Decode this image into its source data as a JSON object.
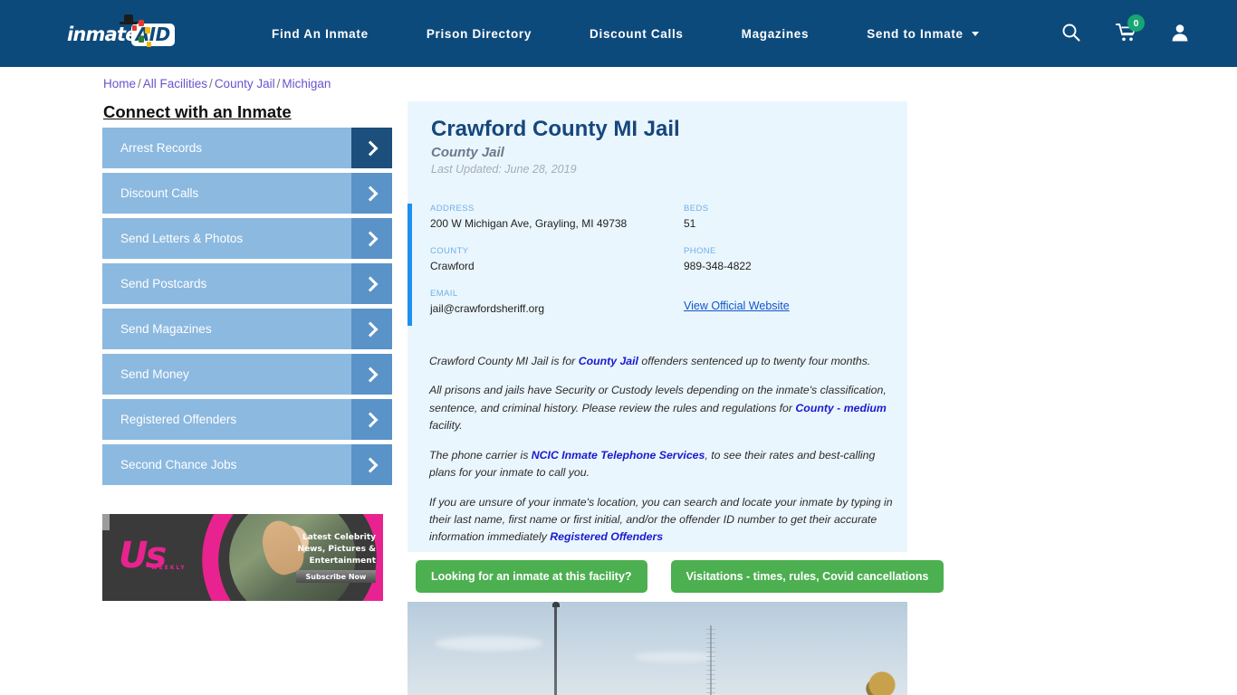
{
  "header": {
    "logo": {
      "word": "inmate",
      "aid": "AID"
    },
    "nav": [
      {
        "label": "Find An Inmate",
        "has_caret": false
      },
      {
        "label": "Prison Directory",
        "has_caret": false
      },
      {
        "label": "Discount Calls",
        "has_caret": false
      },
      {
        "label": "Magazines",
        "has_caret": false
      },
      {
        "label": "Send to Inmate",
        "has_caret": true
      }
    ],
    "icons": {
      "search": "search-icon",
      "cart": "cart-icon",
      "cart_count": "0",
      "account": "user-icon"
    },
    "colors": {
      "bar": "#0d4a7c",
      "badge": "#17a673"
    }
  },
  "breadcrumb": {
    "items": [
      "Home",
      "All Facilities",
      "County Jail",
      "Michigan"
    ],
    "separator": "/"
  },
  "sidebar": {
    "title": "Connect with an Inmate",
    "items": [
      {
        "label": "Arrest Records",
        "active": true
      },
      {
        "label": "Discount Calls",
        "active": false
      },
      {
        "label": "Send Letters & Photos",
        "active": false
      },
      {
        "label": "Send Postcards",
        "active": false
      },
      {
        "label": "Send Magazines",
        "active": false
      },
      {
        "label": "Send Money",
        "active": false
      },
      {
        "label": "Registered Offenders",
        "active": false
      },
      {
        "label": "Second Chance Jobs",
        "active": false
      }
    ]
  },
  "ad": {
    "brand": "Us",
    "brand_sub": "WEEKLY",
    "text": "Latest Celebrity News, Pictures & Entertainment",
    "cta": "Subscribe Now"
  },
  "facility": {
    "title": "Crawford County MI Jail",
    "subtitle": "County Jail",
    "last_updated": "Last Updated: June 28, 2019",
    "fields": [
      {
        "label": "ADDRESS",
        "value": "200 W Michigan Ave, Grayling, MI 49738"
      },
      {
        "label": "BEDS",
        "value": "51"
      },
      {
        "label": "COUNTY",
        "value": "Crawford"
      },
      {
        "label": "PHONE",
        "value": "989-348-4822"
      },
      {
        "label": "EMAIL",
        "value": "jail@crawfordsheriff.org"
      }
    ],
    "website_link": "View Official Website"
  },
  "description": {
    "p1_a": "Crawford County MI Jail is for ",
    "p1_link": "County Jail",
    "p1_b": " offenders sentenced up to twenty four months.",
    "p2_a": "All prisons and jails have Security or Custody levels depending on the inmate's classification, sentence, and criminal history. Please review the rules and regulations for ",
    "p2_link": "County - medium",
    "p2_b": " facility.",
    "p3_a": "The phone carrier is ",
    "p3_link": "NCIC Inmate Telephone Services",
    "p3_b": ", to see their rates and best-calling plans for your inmate to call you.",
    "p4_a": "If you are unsure of your inmate's location, you can search and locate your inmate by typing in their last name, first name or first initial, and/or the offender ID number to get their accurate information immediately ",
    "p4_link": "Registered Offenders"
  },
  "actions": {
    "find_inmate": "Looking for an inmate at this facility?",
    "visitations": "Visitations - times, rules, Covid cancellations"
  }
}
